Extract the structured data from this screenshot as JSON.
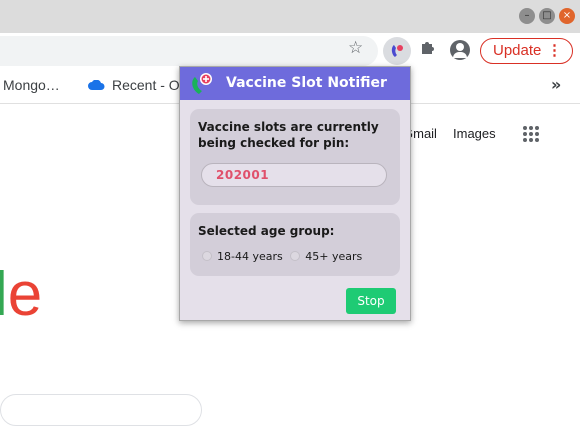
{
  "browser": {
    "window_controls": {
      "minimize": "–",
      "maximize": "□",
      "close": "×"
    },
    "toolbar": {
      "update_label": "Update",
      "update_menu_icon": "⋮",
      "bookmark_star_icon": "star-icon",
      "extensions_icon": "puzzle-icon",
      "profile_icon": "avatar-icon"
    },
    "bookmarks": {
      "items": [
        {
          "label": "Mongo…"
        },
        {
          "label": "Recent - O"
        }
      ],
      "overflow_label": "»"
    }
  },
  "page": {
    "links": {
      "gmail": "Gmail",
      "images": "Images"
    },
    "logo_fragment": {
      "l": "l",
      "e": "e"
    }
  },
  "popup": {
    "title": "Vaccine Slot Notifier",
    "pin_card": {
      "text": "Vaccine slots are currently being checked for pin:",
      "pin_value": "202001"
    },
    "age_card": {
      "label": "Selected age group:",
      "options": [
        {
          "label": "18-44 years"
        },
        {
          "label": "45+ years"
        }
      ]
    },
    "stop_label": "Stop"
  },
  "colors": {
    "popup_header": "#6e6bdc",
    "popup_bg": "#e5e0ea",
    "card_bg": "#d3ced9",
    "pin_text": "#e0506b",
    "stop_button": "#1ecb74",
    "update_red": "#d93025"
  }
}
